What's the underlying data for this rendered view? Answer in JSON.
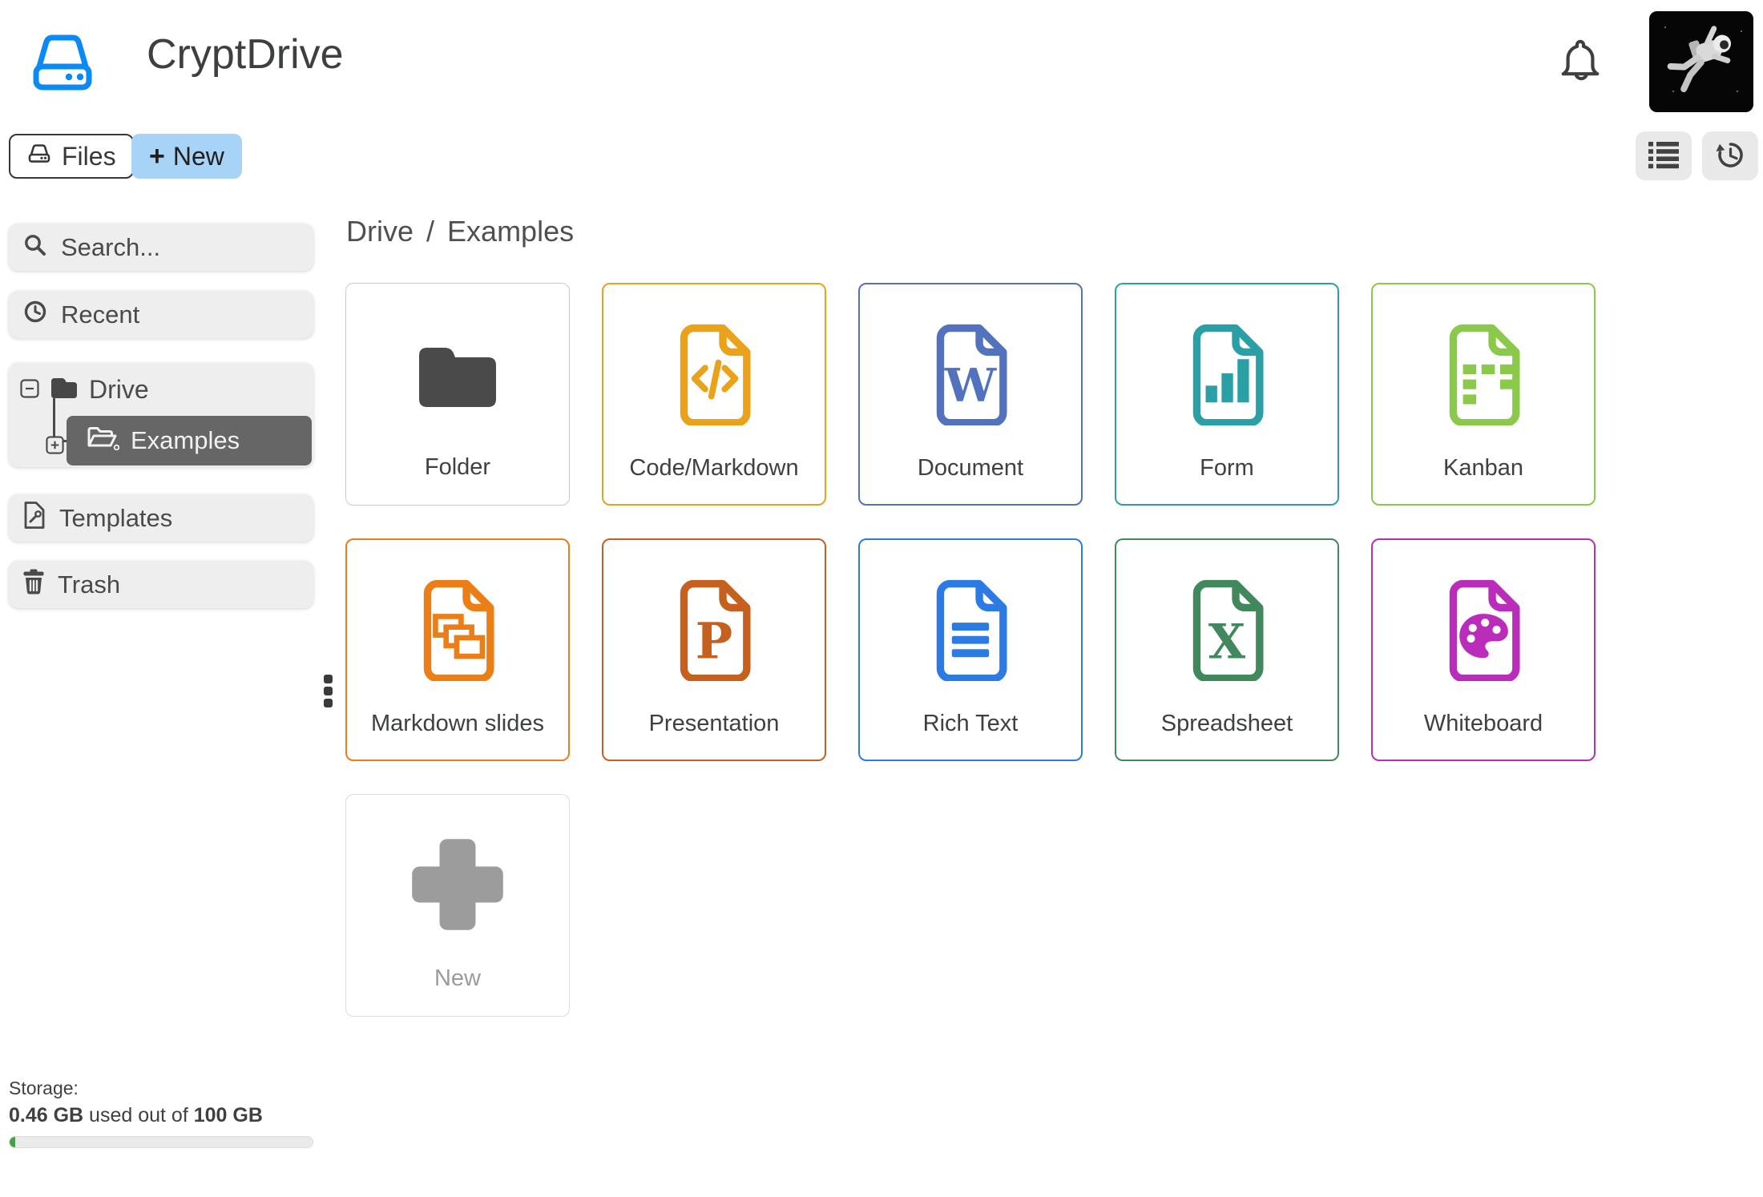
{
  "app": {
    "title": "CryptDrive"
  },
  "header": {
    "icons": {
      "logo": "hard-drive",
      "bell": "notifications-bell",
      "avatar": "astronaut-profile-photo"
    }
  },
  "toolbar": {
    "files_label": "Files",
    "new_plus": "+",
    "new_label": "New",
    "icons": {
      "files_button": "hard-drive",
      "list_button": "list-view",
      "history_button": "history-restore"
    }
  },
  "sidebar": {
    "search_placeholder": "Search...",
    "recent_label": "Recent",
    "tree": {
      "root": "Drive",
      "child": "Examples"
    },
    "templates_label": "Templates",
    "trash_label": "Trash",
    "icons": {
      "search": "magnifier",
      "recent": "clock",
      "root": "folder-closed",
      "child": "folder-open",
      "templates": "file-with-wrench",
      "trash": "trash-can",
      "collapse": "minus-square",
      "expand": "plus-square"
    }
  },
  "storage": {
    "heading": "Storage:",
    "used": "0.46 GB",
    "between": " used out of ",
    "total": "100 GB",
    "percent_used": 0.46
  },
  "breadcrumb": {
    "items": [
      "Drive",
      "Examples"
    ],
    "separator": "/"
  },
  "grid": {
    "items": [
      {
        "label": "Folder",
        "type": "folder",
        "color": "#4A4A4A",
        "border": "#C9C9C9",
        "thin": true
      },
      {
        "label": "Code/Markdown",
        "type": "code",
        "color": "#E9A21A",
        "border": "#E9A21A"
      },
      {
        "label": "Document",
        "type": "document",
        "color": "#5272BE",
        "border": "#5272BE",
        "glyph": "W"
      },
      {
        "label": "Form",
        "type": "form",
        "color": "#2AA0A6",
        "border": "#2AA0A6"
      },
      {
        "label": "Kanban",
        "type": "kanban",
        "color": "#8BC94B",
        "border": "#8BC94B"
      },
      {
        "label": "Markdown slides",
        "type": "slides",
        "color": "#EB7E17",
        "border": "#EB7E17"
      },
      {
        "label": "Presentation",
        "type": "presentation",
        "color": "#C6601E",
        "border": "#C6601E",
        "glyph": "P"
      },
      {
        "label": "Rich Text",
        "type": "richtext",
        "color": "#2C7BE5",
        "border": "#2C7BE5"
      },
      {
        "label": "Spreadsheet",
        "type": "spreadsheet",
        "color": "#41895C",
        "border": "#41895C",
        "glyph": "X"
      },
      {
        "label": "Whiteboard",
        "type": "whiteboard",
        "color": "#BA2DBA",
        "border": "#BA2DBA"
      },
      {
        "label": "New",
        "type": "new",
        "color": "#9C9C9C",
        "border": "#DDDDDD",
        "thin": true,
        "muted": true
      }
    ]
  },
  "colors": {
    "accent_blue": "#0B8AF5",
    "new_button_bg": "#A7D3F7",
    "selected_row_bg": "#666666",
    "progress_green": "#45A245"
  }
}
